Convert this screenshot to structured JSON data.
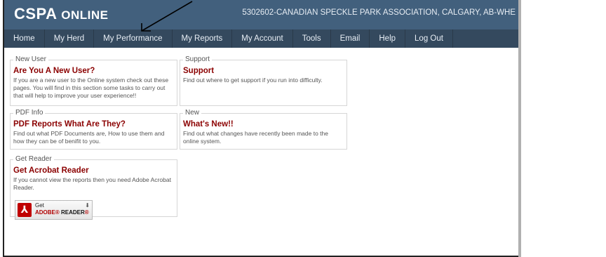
{
  "header": {
    "logo_main": "CSPA ",
    "logo_sc": "ONLINE",
    "association": "5302602-CANADIAN SPECKLE PARK ASSOCIATION, CALGARY, AB-WHE"
  },
  "nav": {
    "items": [
      {
        "label": "Home"
      },
      {
        "label": "My Herd"
      },
      {
        "label": "My Performance"
      },
      {
        "label": "My Reports"
      },
      {
        "label": "My Account"
      },
      {
        "label": "Tools"
      },
      {
        "label": "Email"
      },
      {
        "label": "Help"
      },
      {
        "label": "Log Out"
      }
    ]
  },
  "boxes": {
    "new_user": {
      "legend": "New User",
      "title": "Are You A New User?",
      "desc": "If you are a new user to the Online system check out these pages. You will find in this section some tasks to carry out that will help to improve your user experience!!"
    },
    "support": {
      "legend": "Support",
      "title": "Support",
      "desc": "Find out where to get support if you run into difficulty."
    },
    "pdf_info": {
      "legend": "PDF Info",
      "title": "PDF Reports What Are They?",
      "desc": "Find out what PDF Documents are, How to use them and how they can be of benifit to you."
    },
    "new": {
      "legend": "New",
      "title": "What's New!!",
      "desc": "Find out what changes have recently been made to the online system."
    },
    "get_reader": {
      "legend": "Get Reader",
      "title": "Get Acrobat Reader",
      "desc": "If you cannot view the reports then you need Adobe Acrobat Reader.",
      "button_get": "Get",
      "button_adobe": "ADOBE",
      "button_reader": "READER"
    }
  }
}
